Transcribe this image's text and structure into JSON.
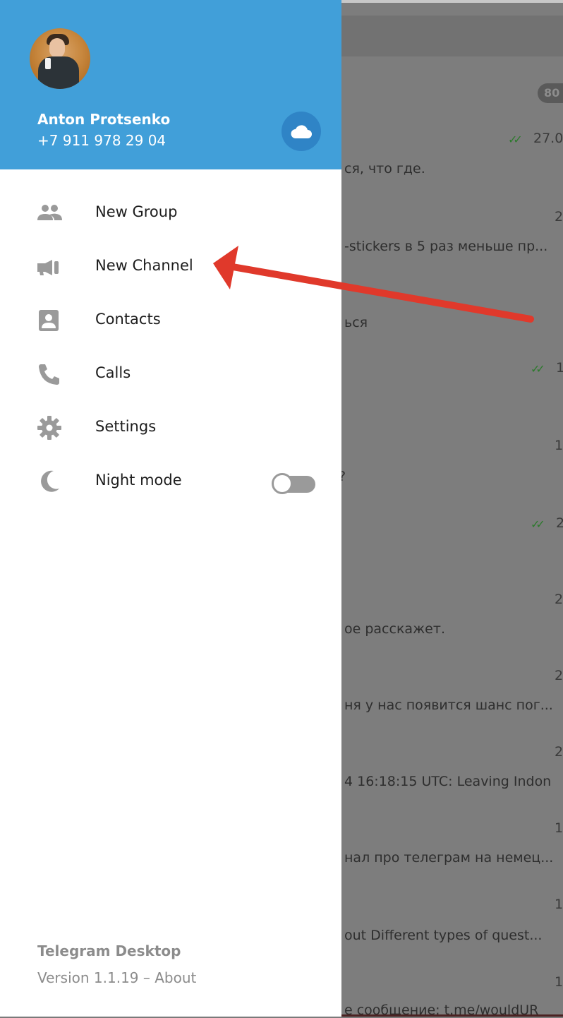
{
  "drawer": {
    "user": {
      "name": "Anton Protsenko",
      "phone": "+7 911 978 29 04"
    },
    "menu": [
      {
        "label": "New Group",
        "icon": "group-icon"
      },
      {
        "label": "New Channel",
        "icon": "megaphone-icon"
      },
      {
        "label": "Contacts",
        "icon": "contact-card-icon"
      },
      {
        "label": "Calls",
        "icon": "phone-icon"
      },
      {
        "label": "Settings",
        "icon": "gear-icon"
      },
      {
        "label": "Night mode",
        "icon": "moon-icon",
        "toggle": false
      }
    ],
    "footer": {
      "app_name": "Telegram Desktop",
      "version": "Version 1.1.19",
      "separator": " – ",
      "about": "About"
    }
  },
  "background": {
    "badge": "80",
    "rows": [
      {
        "time": "27.0",
        "read": true,
        "text": "ся, что где."
      },
      {
        "time": "2",
        "text": "-stickers в 5 раз меньше пр..."
      },
      {
        "time": "",
        "text": "ься"
      },
      {
        "time": "1",
        "read": true,
        "text": ""
      },
      {
        "time": "1",
        "text": "?"
      },
      {
        "time": "2",
        "read": true,
        "text": ""
      },
      {
        "time": "2",
        "text": "ое расскажет."
      },
      {
        "time": "2",
        "text": "ня у нас появится шанс пог..."
      },
      {
        "time": "2",
        "text": "4 16:18:15 UTC: Leaving Indon"
      },
      {
        "time": "1",
        "text": "нал про телеграм на немец..."
      },
      {
        "time": "1",
        "text": "out Different types of quest..."
      },
      {
        "time": "1",
        "text": "е сообщение: t.me/wouldUR"
      }
    ]
  },
  "colors": {
    "header": "#419fd9",
    "arrow": "#e0392b",
    "dim_overlay": "#7d7d7d"
  }
}
